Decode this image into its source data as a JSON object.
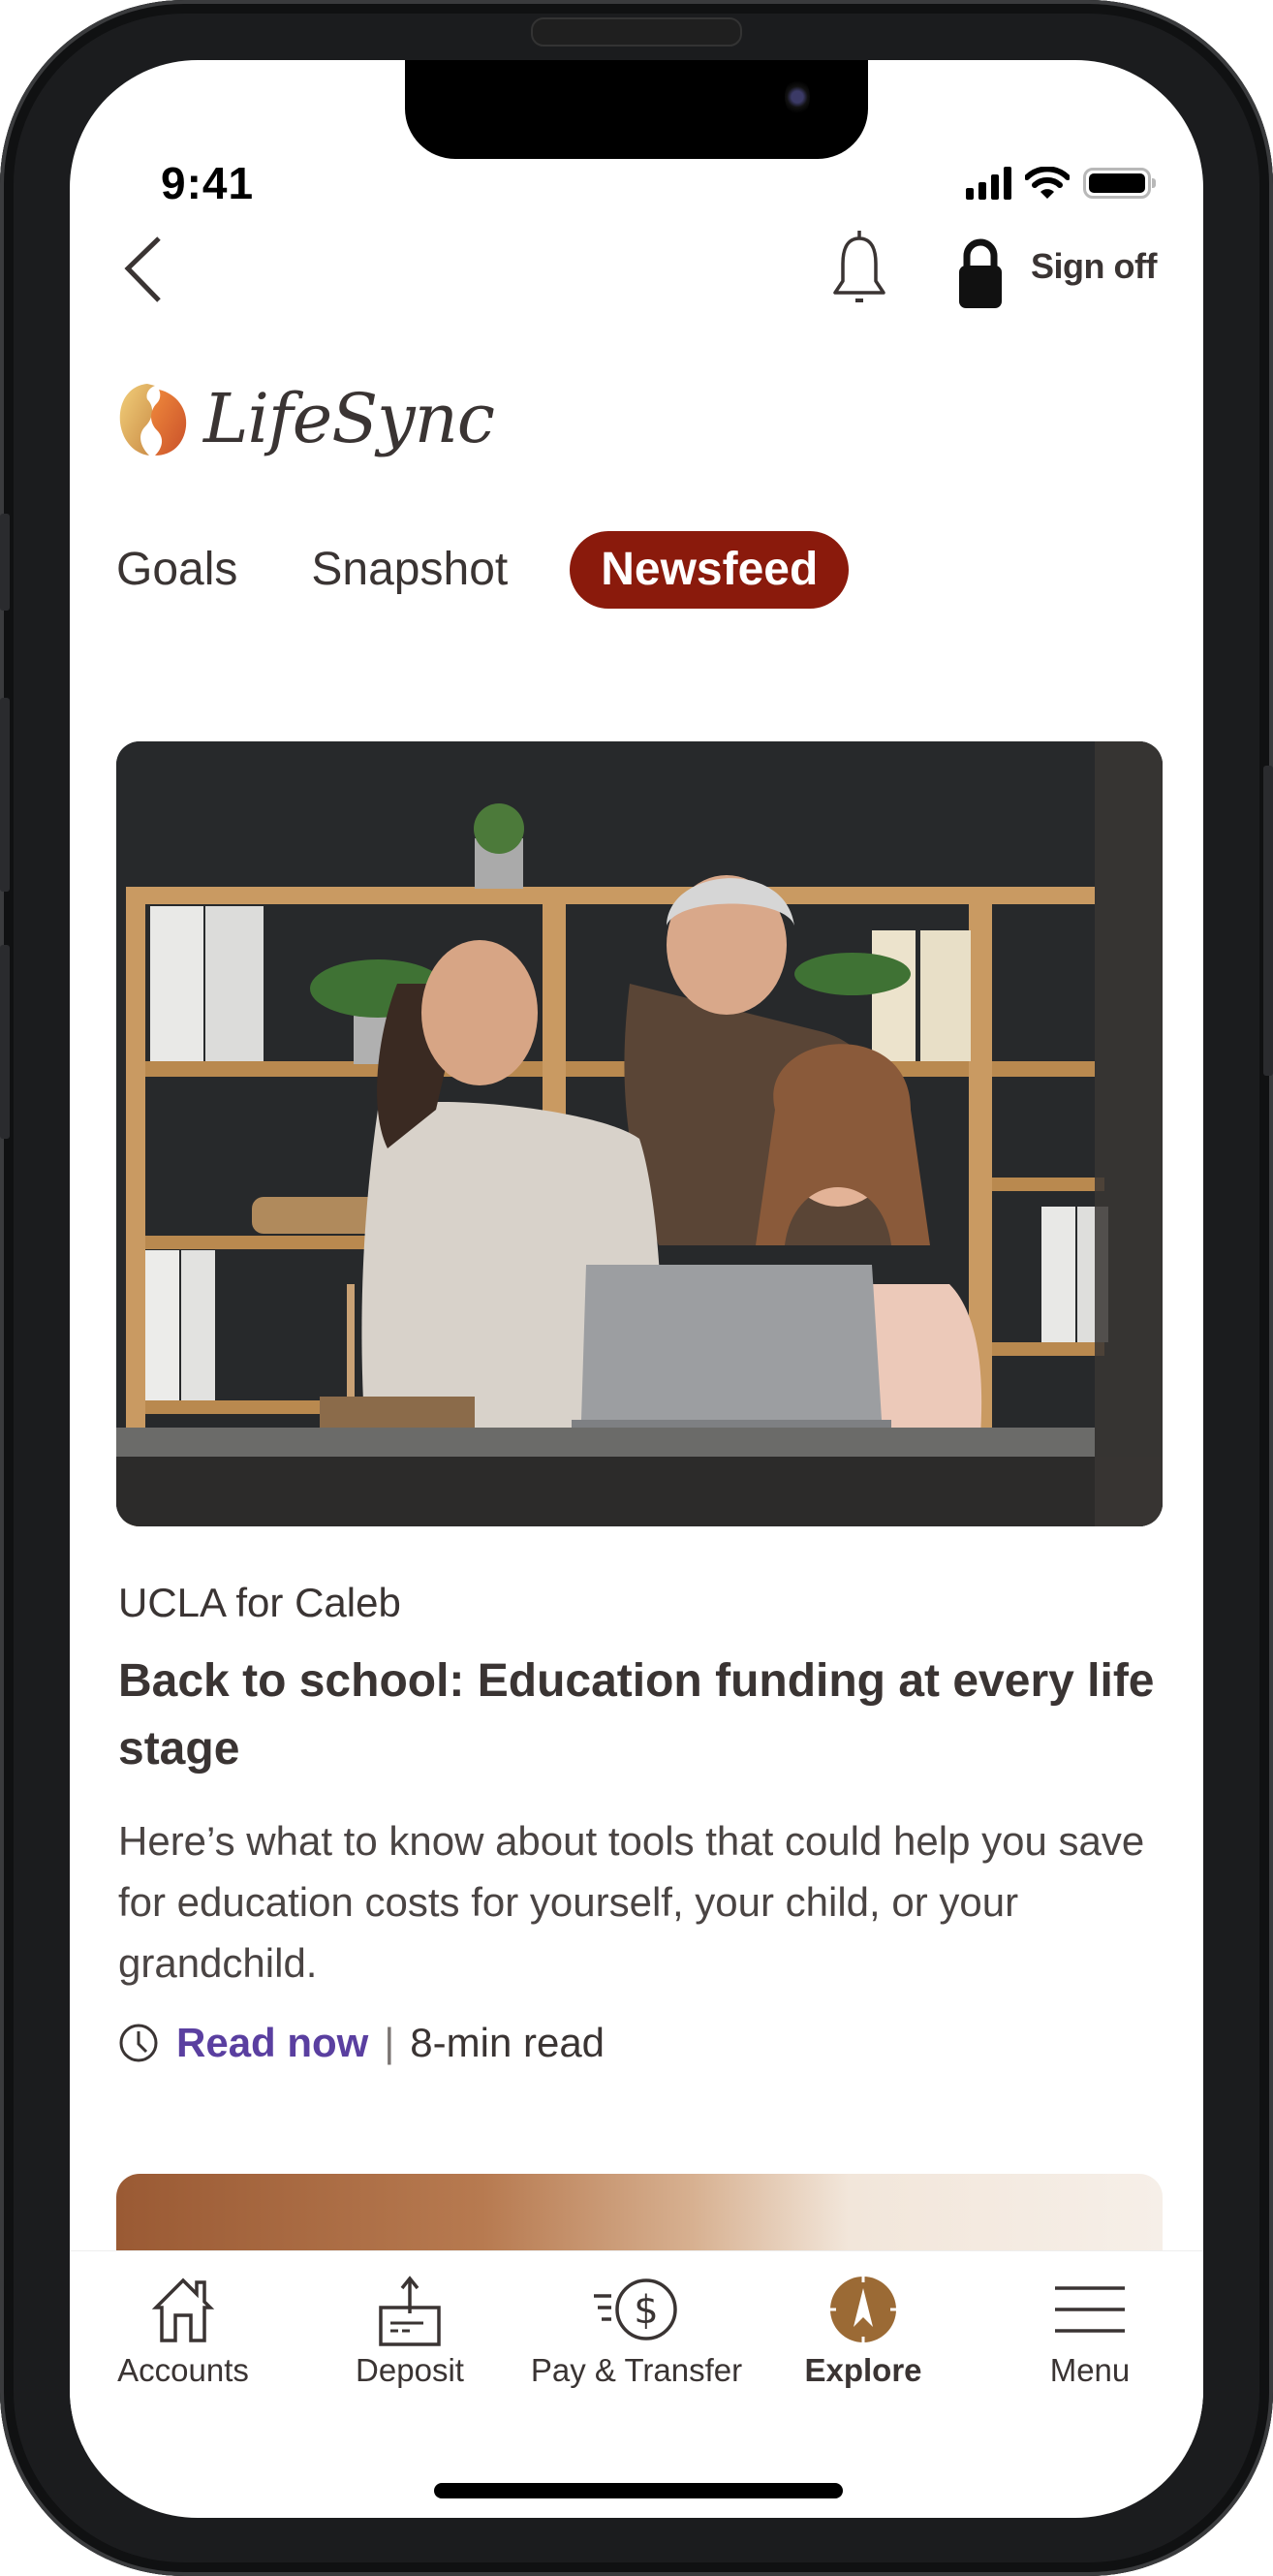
{
  "status_bar": {
    "time": "9:41"
  },
  "header": {
    "back_icon": "chevron-left-icon",
    "notifications_icon": "bell-icon",
    "lock_icon": "lock-icon",
    "sign_off_label": "Sign off"
  },
  "brand": {
    "name": "LifeSync",
    "accent_color": "#8a1a0c"
  },
  "tabs": [
    {
      "label": "Goals",
      "active": false
    },
    {
      "label": "Snapshot",
      "active": false
    },
    {
      "label": "Newsfeed",
      "active": true
    }
  ],
  "article": {
    "image_alt": "Mother, grandfather and daughter looking at a laptop in front of a wooden bookshelf",
    "eyebrow": "UCLA for Caleb",
    "title": "Back to school: Education funding at every life stage",
    "description": "Here’s what to know about tools that could help you save for education costs for yourself, your child, or your grandchild.",
    "cta_label": "Read now",
    "separator": "|",
    "read_time": "8-min read",
    "cta_color": "#5a3fa0"
  },
  "bottom_nav": [
    {
      "label": "Accounts",
      "icon": "house-icon",
      "active": false
    },
    {
      "label": "Deposit",
      "icon": "deposit-icon",
      "active": false
    },
    {
      "label": "Pay & Transfer",
      "icon": "dollar-transfer-icon",
      "active": false
    },
    {
      "label": "Explore",
      "icon": "compass-icon",
      "active": true
    },
    {
      "label": "Menu",
      "icon": "hamburger-icon",
      "active": false
    }
  ],
  "explore_color": "#9b6a35"
}
